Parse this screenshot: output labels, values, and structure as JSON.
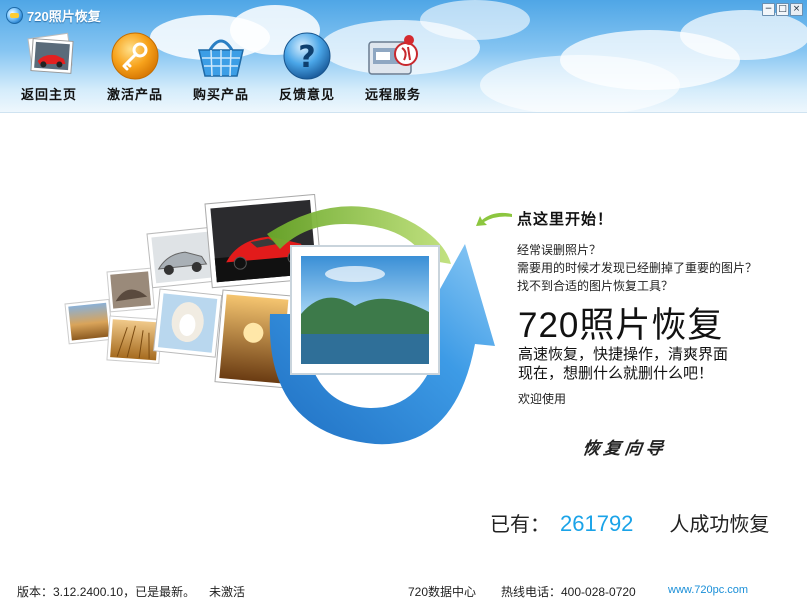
{
  "window": {
    "title": "720照片恢复",
    "min": "−",
    "max": "□",
    "close": "×"
  },
  "toolbar": {
    "items": [
      {
        "label": "返回主页",
        "icon": "home-photo-icon"
      },
      {
        "label": "激活产品",
        "icon": "key-icon"
      },
      {
        "label": "购买产品",
        "icon": "shopping-basket-icon"
      },
      {
        "label": "反馈意见",
        "icon": "question-icon"
      },
      {
        "label": "远程服务",
        "icon": "remote-service-icon"
      }
    ]
  },
  "main": {
    "prompt": "点这里开始！",
    "questions": [
      "经常误删照片？",
      "需要用的时候才发现已经删掉了重要的图片？",
      "找不到合适的图片恢复工具？"
    ],
    "product_name": "720照片恢复",
    "slogan_1": "高速恢复，快捷操作，清爽界面",
    "slogan_2": "现在，想删什么就删什么吧！",
    "welcome": "欢迎使用",
    "wizard": "恢复向导",
    "counter_prefix": "已有：",
    "counter_value": "261792",
    "counter_suffix": "人成功恢复"
  },
  "status": {
    "version": "版本：3.12.2400.10，已是最新。",
    "activation": "未激活",
    "data_center": "720数据中心",
    "hotline": "热线电话：400-028-0720",
    "website": "www.720pc.com"
  },
  "colors": {
    "accent": "#1aa3e8",
    "header_top": "#4fa6e6",
    "arrow_blue": "#2a86d6",
    "arrow_green": "#8cc63f"
  }
}
